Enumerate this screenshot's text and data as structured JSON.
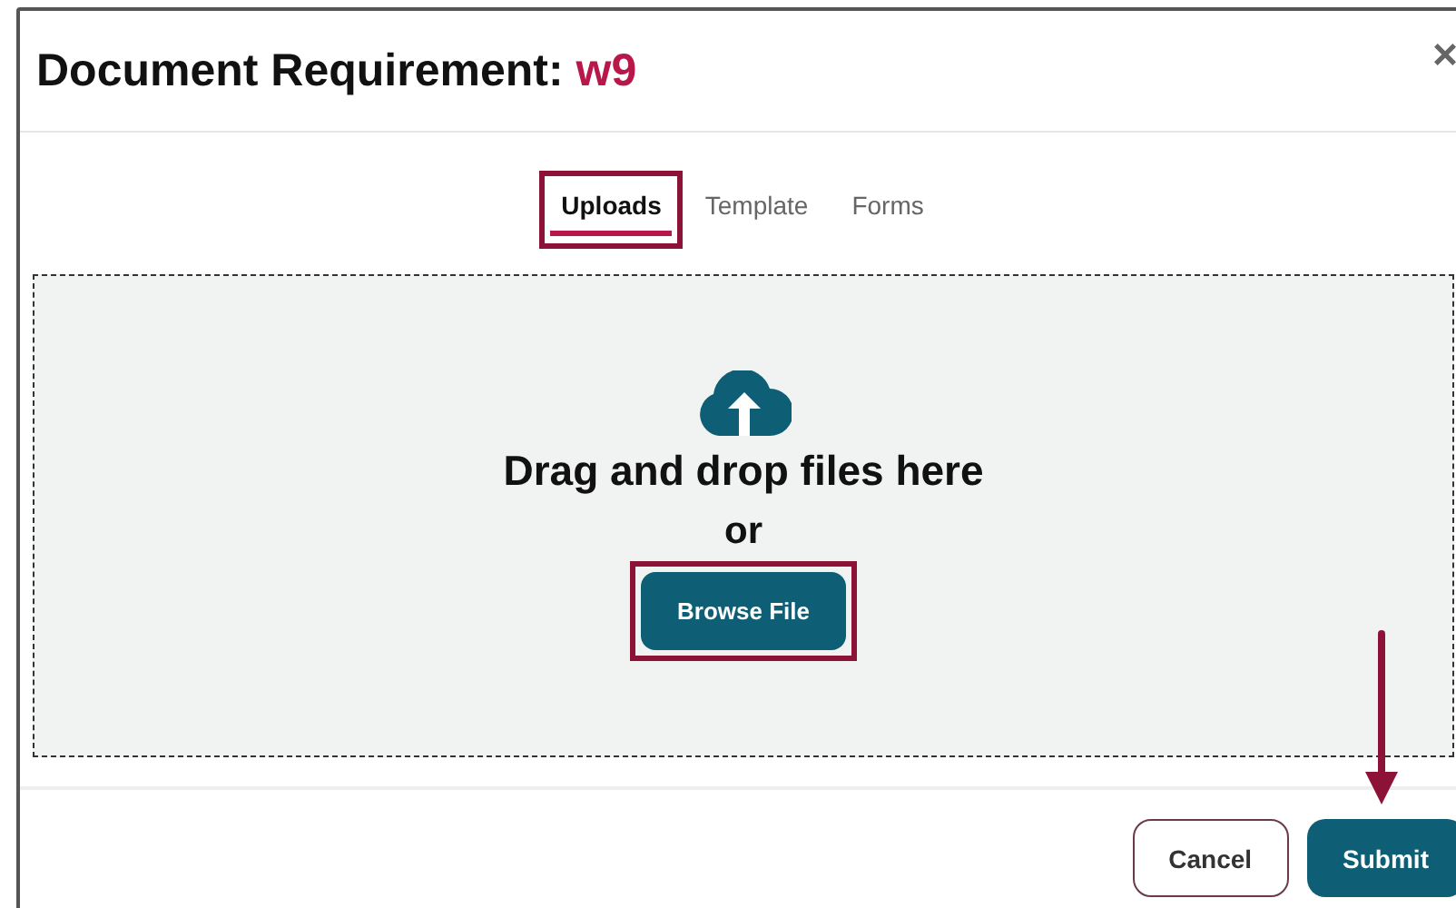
{
  "dialog": {
    "title": "Document Requirement:",
    "requirement_name": "w9",
    "close": "×"
  },
  "tabs": [
    {
      "label": "Uploads",
      "selected": true,
      "highlighted": true
    },
    {
      "label": "Template",
      "selected": false,
      "highlighted": false
    },
    {
      "label": "Forms",
      "selected": false,
      "highlighted": false
    }
  ],
  "dropzone": {
    "prompt": "Drag and drop files here",
    "or": "or",
    "browse_button": {
      "label": "Browse File",
      "highlighted": true
    }
  },
  "footer": {
    "buttons": [
      {
        "label": "Cancel",
        "kind": "secondary",
        "pointed": false
      },
      {
        "label": "Submit",
        "kind": "primary",
        "pointed": true
      }
    ]
  }
}
